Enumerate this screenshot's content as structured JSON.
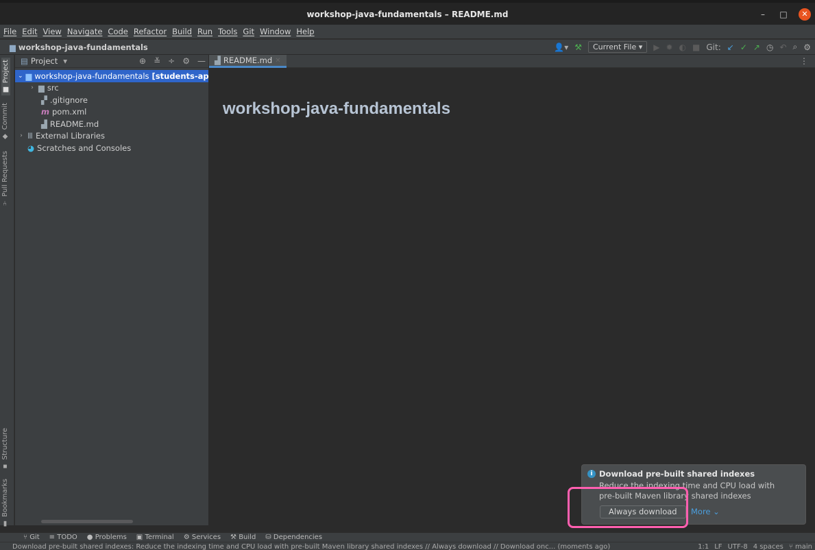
{
  "window": {
    "title": "workshop-java-fundamentals – README.md",
    "minimize": "–",
    "maximize": "□",
    "close": "✕"
  },
  "menu": [
    "File",
    "Edit",
    "View",
    "Navigate",
    "Code",
    "Refactor",
    "Build",
    "Run",
    "Tools",
    "Git",
    "Window",
    "Help"
  ],
  "navbar": {
    "project": "workshop-java-fundamentals",
    "run_config": "Current File",
    "git_label": "Git:"
  },
  "left_strip": {
    "project": "Project",
    "commit": "Commit",
    "pull_requests": "Pull Requests",
    "structure": "Structure",
    "bookmarks": "Bookmarks"
  },
  "project_panel": {
    "title": "Project",
    "root": {
      "name": "workshop-java-fundamentals",
      "tag": "[students-app]"
    },
    "items": [
      "src",
      ".gitignore",
      "pom.xml",
      "README.md"
    ],
    "external": "External Libraries",
    "scratches": "Scratches and Consoles"
  },
  "editor": {
    "tab": "README.md",
    "heading": "workshop-java-fundamentals"
  },
  "notification": {
    "title": "Download pre-built shared indexes",
    "body": "Reduce the indexing time and CPU load with pre-built Maven library shared indexes",
    "action": "Always download",
    "more": "More"
  },
  "toolwindows": [
    "Git",
    "TODO",
    "Problems",
    "Terminal",
    "Services",
    "Build",
    "Dependencies"
  ],
  "status": {
    "message": "Download pre-built shared indexes: Reduce the indexing time and CPU load with pre-built Maven library shared indexes // Always download // Download onc... (moments ago)",
    "position": "1:1",
    "line_sep": "LF",
    "encoding": "UTF-8",
    "indent": "4 spaces",
    "branch": "main"
  }
}
